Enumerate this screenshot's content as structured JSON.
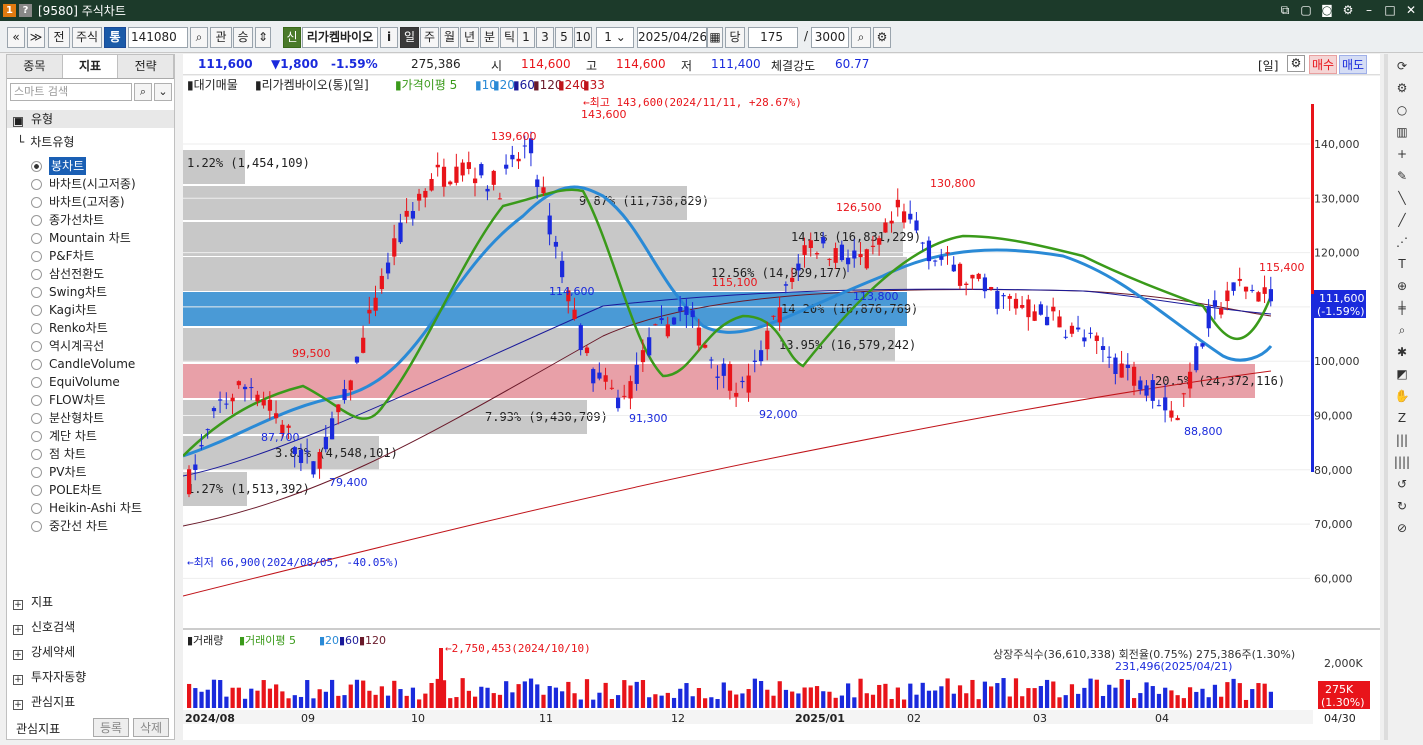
{
  "window": {
    "title": "[9580] 주식차트",
    "icons": [
      "1",
      "?"
    ]
  },
  "toolbar": {
    "prev": "«",
    "menu": "≫",
    "jeon": "전",
    "stock": "주식",
    "tong": "통",
    "code": "141080",
    "gwan": "관",
    "seung": "승",
    "sin": "신",
    "name": "리가켐바이오",
    "i": "i",
    "periods": [
      "일",
      "주",
      "월",
      "년",
      "분",
      "틱"
    ],
    "nums": [
      "1",
      "3",
      "5",
      "10"
    ],
    "input1": "1",
    "date": "2025/04/26",
    "dang": "당",
    "count": "175",
    "slash": "/",
    "total": "3000"
  },
  "left": {
    "tabs": [
      "종목",
      "지표",
      "전략"
    ],
    "search_placeholder": "스마트 검색",
    "type_header": "유형",
    "chart_type_header": "차트유형",
    "chart_types": [
      "봉차트",
      "바차트(시고저종)",
      "바차트(고저종)",
      "종가선차트",
      "Mountain 차트",
      "P&F차트",
      "삼선전환도",
      "Swing차트",
      "Kagi차트",
      "Renko차트",
      "역시계곡선",
      "CandleVolume",
      "EquiVolume",
      "FLOW차트",
      "분산형차트",
      "계단 차트",
      "점 차트",
      "PV차트",
      "POLE차트",
      "Heikin-Ashi 차트",
      "중간선 차트"
    ],
    "sections": [
      "지표",
      "신호검색",
      "강세약세",
      "투자자동향",
      "관심지표"
    ],
    "bottom_label": "관심지표",
    "register": "등록",
    "delete": "삭제"
  },
  "info": {
    "price": "111,600",
    "change": "▼1,800",
    "pct": "-1.59%",
    "volume": "275,386",
    "open_l": "시",
    "open": "114,600",
    "high_l": "고",
    "high": "114,600",
    "low_l": "저",
    "low": "111,400",
    "strength_l": "체결강도",
    "strength": "60.77",
    "period": "[일]",
    "buy": "매수",
    "sell": "매도"
  },
  "legend": {
    "items": [
      "대기매물",
      "리가켐바이오(통)[일]",
      "가격이평 5",
      "10",
      "20",
      "60",
      "120",
      "240",
      "33"
    ]
  },
  "annotations": {
    "max": "←최고 143,600(2024/11/11, +28.67%)",
    "min": "←최저 66,900(2024/08/05, -40.05%)",
    "vol_max": "←2,750,453(2024/10/10)",
    "shares": "상장주식수(36,610,338) 회전율(0.75%) 275,386주(1.30%)",
    "avg": "231,496(2025/04/21)",
    "price_tag": "111,600",
    "price_pct": "(-1.59%)",
    "vol_tag": "275K",
    "vol_pct": "(1.30%)",
    "date_tag": "04/30"
  },
  "peaks": [
    {
      "v": "143,600"
    },
    {
      "v": "139,600"
    },
    {
      "v": "99,500"
    },
    {
      "v": "87,700"
    },
    {
      "v": "79,400"
    },
    {
      "v": "114,600"
    },
    {
      "v": "91,300"
    },
    {
      "v": "115,100"
    },
    {
      "v": "92,000"
    },
    {
      "v": "126,500"
    },
    {
      "v": "113,800"
    },
    {
      "v": "130,800"
    },
    {
      "v": "88,800"
    },
    {
      "v": "115,400"
    }
  ],
  "profile": [
    {
      "t": "1.22% (1,454,109)"
    },
    {
      "t": "9.87% (11,738,829)"
    },
    {
      "t": "14.1% (16,831,229)"
    },
    {
      "t": "12.56% (14,929,177)"
    },
    {
      "t": "14.20% (16,876,769)"
    },
    {
      "t": "13.95% (16,579,242)"
    },
    {
      "t": "20.5% (24,372,116)"
    },
    {
      "t": "7.93% (9,430,709)"
    },
    {
      "t": "3.83% (4,548,101)"
    },
    {
      "t": "1.27% (1,513,392)"
    }
  ],
  "yaxis": [
    "140,000",
    "130,000",
    "120,000",
    "110,000",
    "100,000",
    "90,000",
    "80,000",
    "70,000",
    "60,000"
  ],
  "vyaxis": "2,000K",
  "xaxis": [
    "2024/08",
    "09",
    "10",
    "11",
    "12",
    "2025/01",
    "02",
    "03",
    "04"
  ],
  "volume_legend": [
    "거래량",
    "거래이평 5",
    "20",
    "60",
    "120"
  ],
  "colors": {
    "up": "#e8141a",
    "down": "#1a2adc"
  }
}
